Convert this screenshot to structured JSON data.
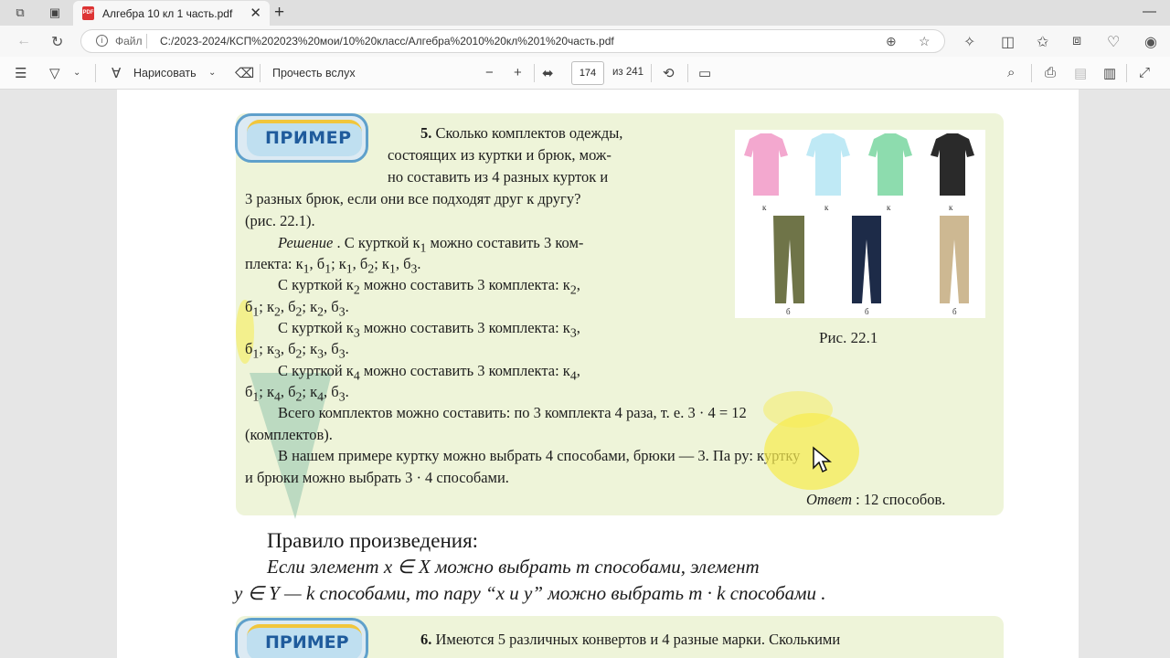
{
  "browser": {
    "tab_title": "Алгебра 10 кл 1 часть.pdf",
    "tab_close": "✕",
    "new_tab": "+",
    "address": {
      "scheme_label": "Файл",
      "url": "C:/2023-2024/КСП%202023%20мои/10%20класс/Алгебра%2010%20кл%201%20часть.pdf"
    },
    "window": {
      "minimize": "—"
    }
  },
  "pdf_toolbar": {
    "draw_label": "Нарисовать",
    "read_aloud_label": "Прочесть вслух",
    "zoom_out": "−",
    "zoom_in": "+",
    "current_page": "174",
    "total_pages": "из 241"
  },
  "page": {
    "example_badge": "ПРИМЕР",
    "example5": {
      "lines": [
        "<b>5.</b>  Сколько   комплектов   одежды,",
        "состоящих   из  куртки   и  брюк,  мож-",
        "но  составить   из  4  разных   курток    и",
        "3  разных   брюк,  если  они  все  подходят   друг  к  другу?",
        "(рис.   22.1).",
        "<i>Решение</i> .  С  курткой    к<sub>1</sub>  можно   составить   3  ком-",
        "плекта:   к<sub>1</sub>,  б<sub>1</sub>;  к<sub>1</sub>,  б<sub>2</sub>;  к<sub>1</sub>,  б<sub>3</sub>.",
        "С  курткой    к<sub>2</sub>  можно    составить   3  комплекта:    к<sub>2</sub>,",
        "б<sub>1</sub>;  к<sub>2</sub>,  б<sub>2</sub>;  к<sub>2</sub>,  б<sub>3</sub>.",
        "С  курткой    к<sub>3</sub>  можно    составить   3  комплекта:    к<sub>3</sub>,",
        "б<sub>1</sub>;  к<sub>3</sub>,  б<sub>2</sub>;  к<sub>3</sub>,  б<sub>3</sub>.",
        "С  курткой     к<sub>4</sub>  можно    составить   3  комплекта:    к<sub>4</sub>,",
        "б<sub>1</sub>;  к<sub>4</sub>,  б<sub>2</sub>;  к<sub>4</sub>,  б<sub>3</sub>.",
        "Всего  комплектов     можно   составить:   по  3  комплекта    4  раза,    т.   е.   3  ·  4  =  12",
        "(комплектов).",
        "В  нашем  примере  куртку   можно  выбрать   4  способами,    брюки —  3.  Па ру:  куртку",
        "и  брюки   можно    выбрать    3  ·  4  способами.",
        "<i>Ответ</i>  :  12   способов."
      ],
      "figure_caption": "Рис.   22.1",
      "figure_labels": [
        "к",
        "к",
        "к",
        "к",
        "б",
        "б",
        "б"
      ]
    },
    "rule_title": "Правило    произведения:",
    "rule_line1": "Если     элемент      x  ∈  X  можно   выбрать     m  способами,     элемент",
    "rule_line2": "y ∈ Y — k    способами,    то  пару    “x  и  y”  можно  выбрать    m  ·  k  способами  .",
    "example6": "<b>6.</b>  Имеются   5  различных     конвертов    и  4  разные   марки.   Сколькими"
  },
  "colors": {
    "example_bg": "#eef4d9",
    "badge_blue": "#1f5b9c",
    "highlight": "#f7ec4f"
  }
}
